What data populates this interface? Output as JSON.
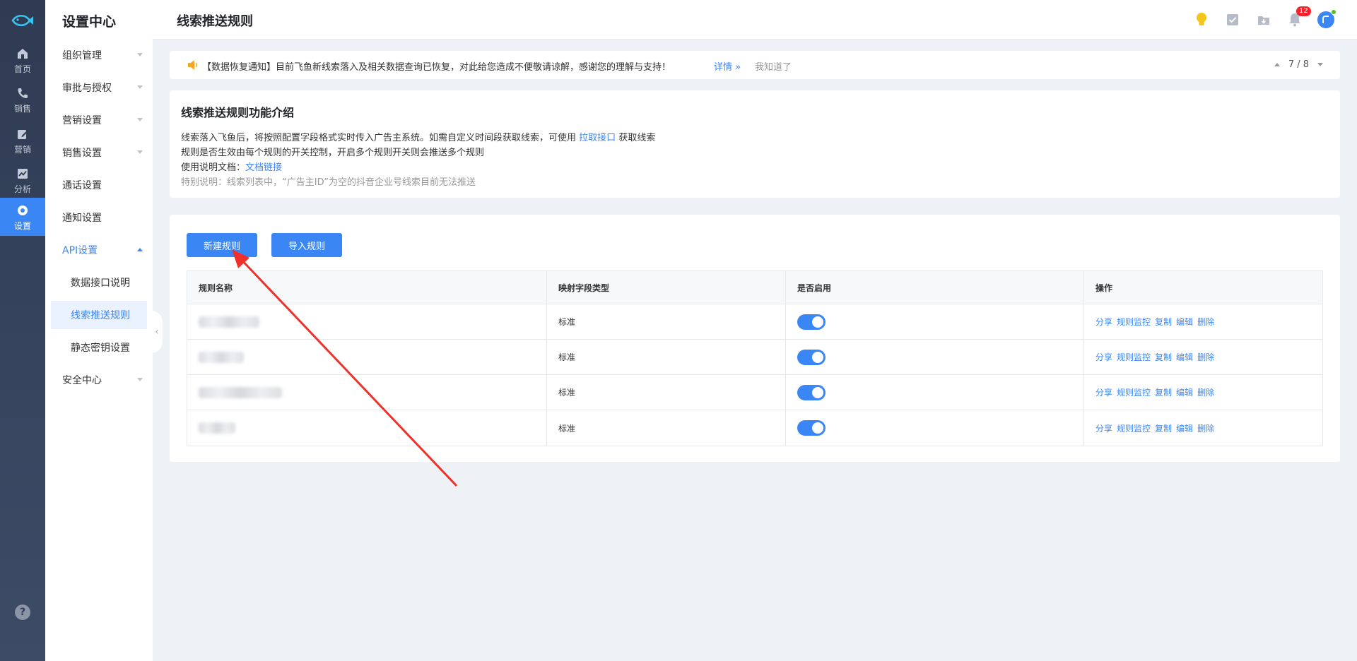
{
  "rail": {
    "items": [
      {
        "label": "首页",
        "icon": "home-icon"
      },
      {
        "label": "销售",
        "icon": "phone-icon"
      },
      {
        "label": "营销",
        "icon": "edit-icon"
      },
      {
        "label": "分析",
        "icon": "chart-icon"
      },
      {
        "label": "设置",
        "icon": "gear-icon"
      }
    ],
    "help": "?"
  },
  "sidebar": {
    "title": "设置中心",
    "items": [
      {
        "label": "组织管理"
      },
      {
        "label": "审批与授权"
      },
      {
        "label": "营销设置"
      },
      {
        "label": "销售设置"
      },
      {
        "label": "通话设置"
      },
      {
        "label": "通知设置"
      },
      {
        "label": "API设置"
      },
      {
        "label": "安全中心"
      }
    ],
    "sub_items": [
      {
        "label": "数据接口说明"
      },
      {
        "label": "线索推送规则"
      },
      {
        "label": "静态密钥设置"
      }
    ]
  },
  "topbar": {
    "title": "线索推送规则",
    "notification_count": "12"
  },
  "notice": {
    "text": "【数据恢复通知】目前飞鱼新线索落入及相关数据查询已恢复，对此给您造成不便敬请谅解，感谢您的理解与支持！",
    "detail_label": "详情 »",
    "dismiss_label": "我知道了",
    "pager": "7 / 8"
  },
  "intro": {
    "heading": "线索推送规则功能介绍",
    "line1_prefix": "线索落入飞鱼后，将按照配置字段格式实时传入广告主系统。如需自定义时间段获取线索，可使用",
    "line1_link": "拉取接口",
    "line1_suffix": "获取线索",
    "line2": "规则是否生效由每个规则的开关控制，开启多个规则开关则会推送多个规则",
    "line3_prefix": "使用说明文档：",
    "line3_link": "文档链接",
    "line4": "特别说明：线索列表中，“广告主ID”为空的抖音企业号线索目前无法推送"
  },
  "actions": {
    "new_rule": "新建规则",
    "import_rule": "导入规则"
  },
  "table": {
    "headers": [
      "规则名称",
      "映射字段类型",
      "是否启用",
      "操作"
    ],
    "rows": [
      {
        "type": "标准",
        "enabled": true
      },
      {
        "type": "标准",
        "enabled": true
      },
      {
        "type": "标准",
        "enabled": true
      },
      {
        "type": "标准",
        "enabled": true
      }
    ],
    "operations": [
      "分享",
      "规则监控",
      "复制",
      "编辑",
      "删除"
    ]
  },
  "colors": {
    "accent": "#3a86f5",
    "rail_bg": "#2f3b52",
    "arrow": "#f0312b",
    "badge": "#f5222d"
  }
}
